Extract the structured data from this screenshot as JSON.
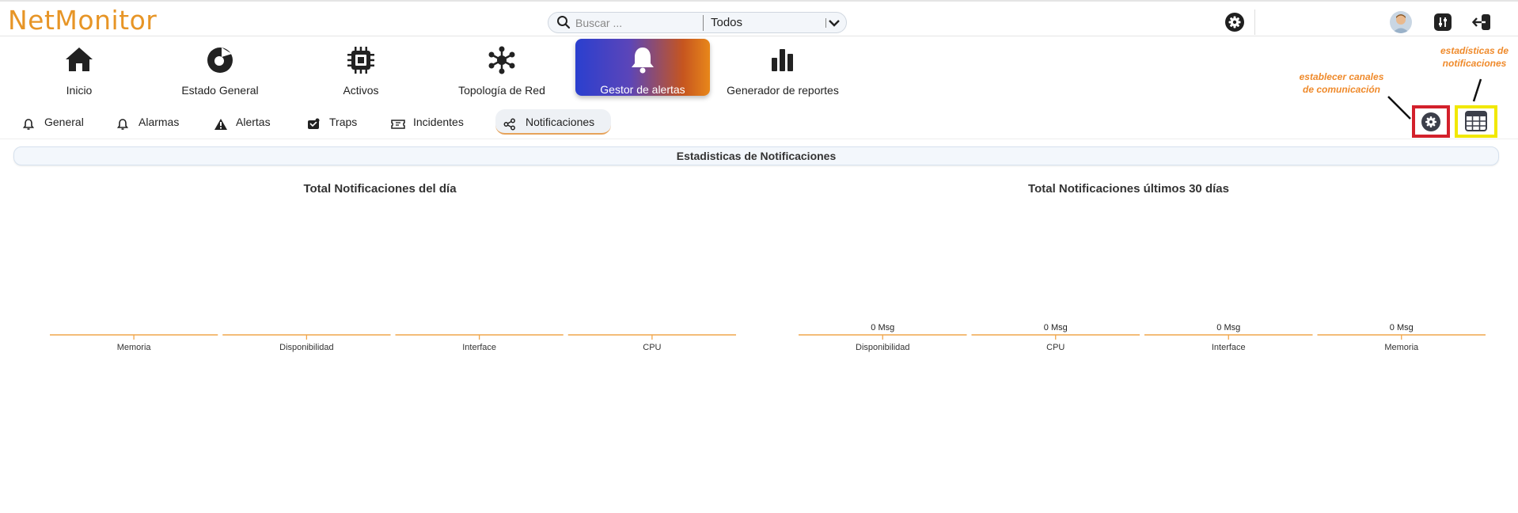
{
  "app": {
    "logo": "NetMonitor"
  },
  "search": {
    "placeholder": "Buscar ...",
    "value": "",
    "scope": "Todos"
  },
  "main_nav": [
    {
      "label": "Inicio",
      "icon": "home-icon"
    },
    {
      "label": "Estado General",
      "icon": "pie-status-icon"
    },
    {
      "label": "Activos",
      "icon": "chip-icon"
    },
    {
      "label": "Topología de Red",
      "icon": "network-topology-icon"
    },
    {
      "label": "Gestor de alertas",
      "icon": "bell-icon",
      "active": true
    },
    {
      "label": "Generador de reportes",
      "icon": "bar-chart-icon"
    }
  ],
  "sub_nav": [
    {
      "label": "General",
      "icon": "bell-outline-icon"
    },
    {
      "label": "Alarmas",
      "icon": "bell-outline-icon"
    },
    {
      "label": "Alertas",
      "icon": "warning-icon"
    },
    {
      "label": "Traps",
      "icon": "trap-icon"
    },
    {
      "label": "Incidentes",
      "icon": "ticket-icon"
    },
    {
      "label": "Notificaciones",
      "icon": "share-icon",
      "active": true
    }
  ],
  "annotations": {
    "channels": [
      "establecer canales",
      "de comunicación"
    ],
    "stats": [
      "estadísticas de",
      "notificaciones"
    ]
  },
  "section_title": "Estadisticas de Notificaciones",
  "colors": {
    "accent": "#e79526",
    "axis": "#f0a64b",
    "highlight_red": "#d3202b",
    "highlight_yellow": "#f1e800"
  },
  "chart_data": [
    {
      "type": "bar",
      "title": "Total Notificaciones del día",
      "categories": [
        "Memoria",
        "Disponibilidad",
        "Interface",
        "CPU"
      ],
      "values": [
        0,
        0,
        0,
        0
      ],
      "data_labels": []
    },
    {
      "type": "bar",
      "title": "Total Notificaciones últimos 30 días",
      "categories": [
        "Disponibilidad",
        "CPU",
        "Interface",
        "Memoria"
      ],
      "values": [
        0,
        0,
        0,
        0
      ],
      "data_labels": [
        "0 Msg",
        "0 Msg",
        "0 Msg",
        "0 Msg"
      ]
    }
  ]
}
